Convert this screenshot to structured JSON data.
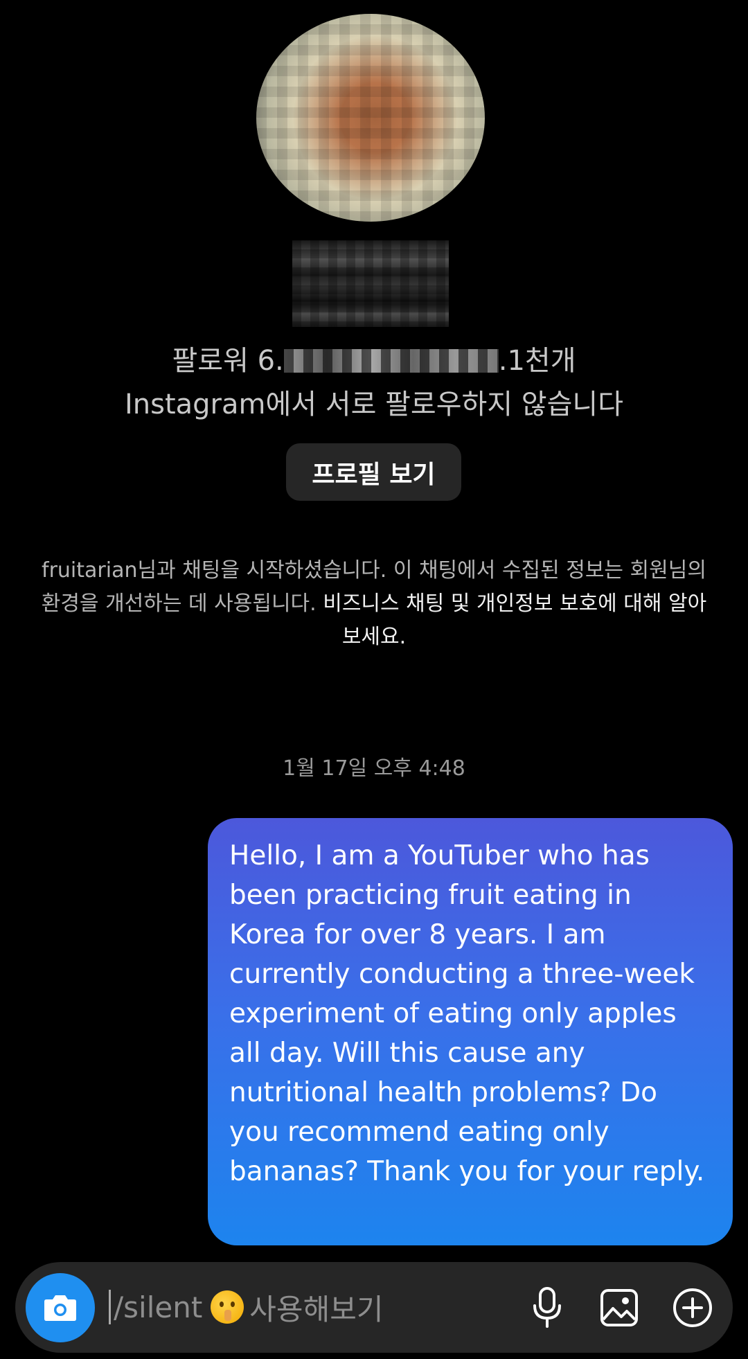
{
  "profile": {
    "stats_prefix": "팔로워 6.",
    "stats_suffix": ".1천개",
    "follow_status": "Instagram에서 서로 팔로우하지 않습니다",
    "view_profile_label": "프로필 보기"
  },
  "notice": {
    "text": "fruitarian님과 채팅을 시작하셨습니다. 이 채팅에서 수집된 정보는 회원님의 환경을 개선하는 데 사용됩니다. ",
    "link": "비즈니스 채팅 및 개인정보 보호에 대해 알아보세요."
  },
  "conversation": {
    "timestamp": "1월 17일 오후 4:48",
    "messages": [
      {
        "direction": "outgoing",
        "text": "Hello, I am a YouTuber who has been practicing fruit eating in Korea for over 8 years.  I am currently conducting a three-week experiment of eating only apples all day. Will this cause any nutritional health problems?  Do you recommend eating only bananas?  Thank you for your reply."
      }
    ]
  },
  "composer": {
    "placeholder_prefix": "/silent",
    "placeholder_suffix": "사용해보기",
    "emoji_icon": "shushing-face-emoji",
    "icons": [
      "camera-icon",
      "microphone-icon",
      "image-icon",
      "plus-circle-icon"
    ]
  },
  "colors": {
    "background": "#000000",
    "bubble_top": "#4c58db",
    "bubble_bottom": "#1d84ee",
    "camera_button": "#1f8ff0",
    "composer": "#262626"
  }
}
